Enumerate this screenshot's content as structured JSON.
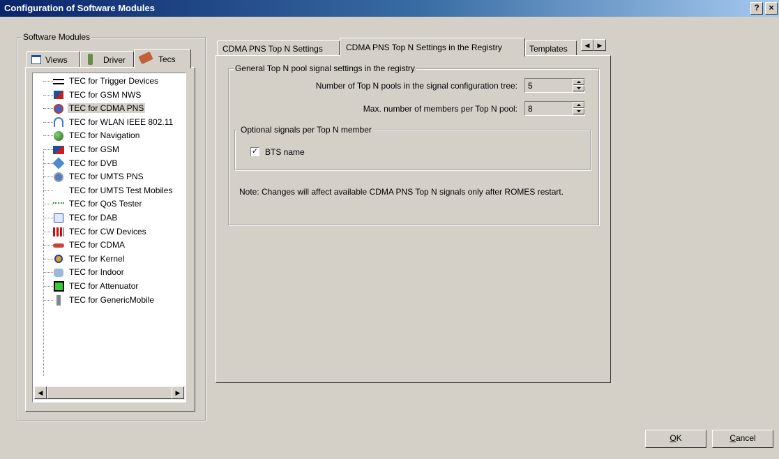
{
  "window": {
    "title": "Configuration of Software Modules",
    "help_label": "?",
    "close_label": "×"
  },
  "left_group": {
    "title": "Software Modules",
    "tabs": [
      {
        "label": "Views",
        "icon": "window-icon"
      },
      {
        "label": "Driver",
        "icon": "phone-icon"
      },
      {
        "label": "Tecs",
        "icon": "tecs-icon",
        "active": true
      }
    ],
    "tree_items": [
      {
        "label": "TEC for Trigger Devices",
        "icon": "trigger-icon"
      },
      {
        "label": "TEC for GSM NWS",
        "icon": "gsm-nws-icon"
      },
      {
        "label": "TEC for CDMA PNS",
        "icon": "cdma-pns-icon",
        "selected": true
      },
      {
        "label": "TEC for WLAN IEEE 802.11",
        "icon": "wlan-icon"
      },
      {
        "label": "TEC for Navigation",
        "icon": "navigation-icon"
      },
      {
        "label": "TEC for GSM",
        "icon": "gsm-icon"
      },
      {
        "label": "TEC for DVB",
        "icon": "dvb-icon"
      },
      {
        "label": "TEC for UMTS PNS",
        "icon": "umts-pns-icon"
      },
      {
        "label": "TEC for UMTS Test Mobiles",
        "icon": "umts-test-icon"
      },
      {
        "label": "TEC for QoS Tester",
        "icon": "qos-icon"
      },
      {
        "label": "TEC for DAB",
        "icon": "dab-icon"
      },
      {
        "label": "TEC for CW Devices",
        "icon": "cw-icon"
      },
      {
        "label": "TEC for CDMA",
        "icon": "cdma-icon"
      },
      {
        "label": "TEC for Kernel",
        "icon": "kernel-icon"
      },
      {
        "label": "TEC for Indoor",
        "icon": "indoor-icon"
      },
      {
        "label": "TEC for Attenuator",
        "icon": "attenuator-icon"
      },
      {
        "label": "TEC for GenericMobile",
        "icon": "generic-mobile-icon"
      }
    ],
    "scroll_left": "◀",
    "scroll_right": "▶"
  },
  "right_tabs": [
    {
      "label": "CDMA PNS Top N Settings"
    },
    {
      "label": "CDMA PNS Top N Settings in the Registry",
      "active": true
    },
    {
      "label": "Templates"
    }
  ],
  "tab_scroll": {
    "left": "◀",
    "right": "▶"
  },
  "registry": {
    "group_title": "General Top N pool signal settings in the registry",
    "pools_label": "Number of Top N pools in the signal configuration tree:",
    "pools_value": "5",
    "members_label": "Max. number of members per Top N pool:",
    "members_value": "8",
    "optional_group_title": "Optional signals per Top N member",
    "bts_label": "BTS name",
    "bts_checked": true,
    "bts_check_glyph": "✓",
    "note": "Note: Changes will affect available CDMA PNS Top N signals only after ROMES restart."
  },
  "buttons": {
    "ok_mnemonic": "O",
    "ok_rest": "K",
    "cancel_mnemonic": "C",
    "cancel_rest": "ancel"
  }
}
